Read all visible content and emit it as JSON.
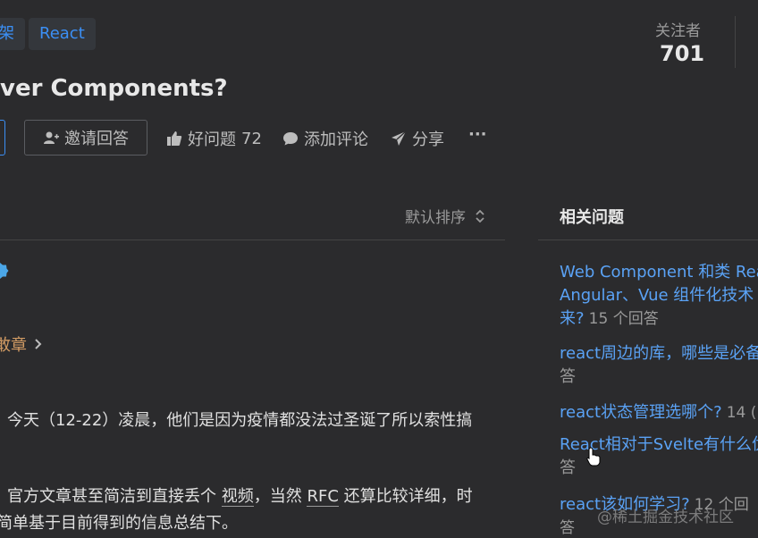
{
  "header": {
    "topics": [
      "架",
      "React"
    ],
    "question_title": "ver Components?"
  },
  "stats": {
    "followers_label": "关注者",
    "followers_value": "701"
  },
  "actions": {
    "invite_label": "邀请回答",
    "good_question_label": "好问题",
    "good_question_count": "72",
    "comment_label": "添加评论",
    "share_label": "分享",
    "more_label": "···"
  },
  "answers": {
    "sort_label": "默认排序",
    "article_link": "敢章",
    "line1": "今天（12-22）凌晨，他们是因为疫情都没法过圣诞了所以索性搞",
    "line2_a": "官方文章甚至简洁到直接丢个",
    "line2_video": "视频",
    "line2_b": "，当然",
    "line2_rfc": "RFC",
    "line2_c": "还算比较详细，时",
    "line3": "简单基于目前得到的信息总结下。"
  },
  "related": {
    "title": "相关问题",
    "items": [
      {
        "line1": "Web Component 和类 Reac",
        "line2": "Angular、Vue 组件化技术",
        "line3": "来?",
        "count": "15 个回答"
      },
      {
        "line1": "react周边的库，哪些是必备的",
        "line2": "答",
        "count": ""
      },
      {
        "line1": "react状态管理选哪个?",
        "count": "14 ("
      },
      {
        "line1": "React相对于Svelte有什么优",
        "line2": "答",
        "count": ""
      },
      {
        "line1": "react该如何学习?",
        "count": "12 个回答"
      }
    ]
  },
  "watermark": "@稀土掘金技术社区"
}
